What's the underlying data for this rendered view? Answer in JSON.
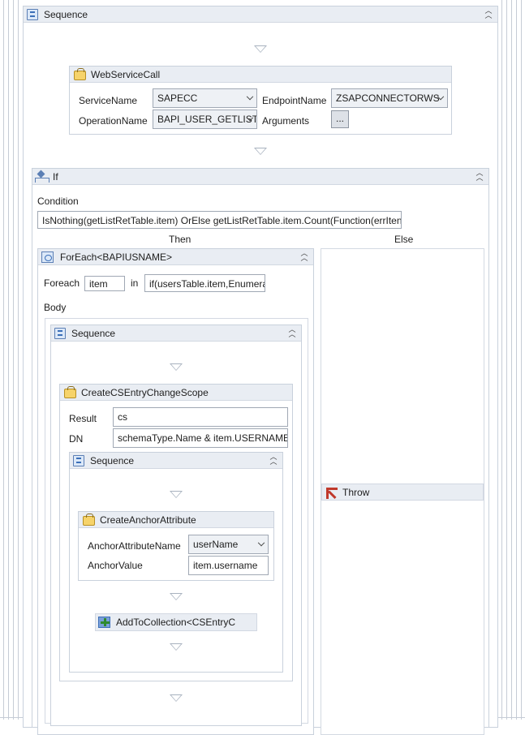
{
  "colors": {
    "header_bg": "#e9edf3",
    "border": "#c9d1dc",
    "arrow": "#a8b2bf",
    "throw_icon": "#c0392b"
  },
  "outer_sequence": {
    "title": "Sequence",
    "icon": "sequence-icon"
  },
  "webservice": {
    "title": "WebServiceCall",
    "icon": "code-activity-icon",
    "service_name_label": "ServiceName",
    "service_name_value": "SAPECC",
    "endpoint_label": "EndpointName",
    "endpoint_value": "ZSAPCONNECTORWS",
    "operation_label": "OperationName",
    "operation_value": "BAPI_USER_GETLIST",
    "arguments_label": "Arguments",
    "arguments_button": "..."
  },
  "if_activity": {
    "title": "If",
    "icon": "if-icon",
    "condition_label": "Condition",
    "condition_value": "IsNothing(getListRetTable.item) OrElse  getListRetTable.item.Count(Function(errIten",
    "then_label": "Then",
    "else_label": "Else"
  },
  "foreach": {
    "title": "ForEach<BAPIUSNAME>",
    "icon": "foreach-icon",
    "foreach_label": "Foreach",
    "item_value": "item",
    "in_label": "in",
    "in_value": "if(usersTable.item,Enumera",
    "body_label": "Body"
  },
  "inner_sequence": {
    "title": "Sequence"
  },
  "changescope": {
    "title": "CreateCSEntryChangeScope",
    "result_label": "Result",
    "result_value": "cs",
    "dn_label": "DN",
    "dn_value": "schemaType.Name & item.USERNAME"
  },
  "innermost_sequence": {
    "title": "Sequence"
  },
  "anchor": {
    "title": "CreateAnchorAttribute",
    "name_label": "AnchorAttributeName",
    "name_value": "userName",
    "value_label": "AnchorValue",
    "value_value": "item.username"
  },
  "addto": {
    "title": "AddToCollection<CSEntryC"
  },
  "throw_activity": {
    "title": "Throw",
    "icon": "throw-icon"
  }
}
